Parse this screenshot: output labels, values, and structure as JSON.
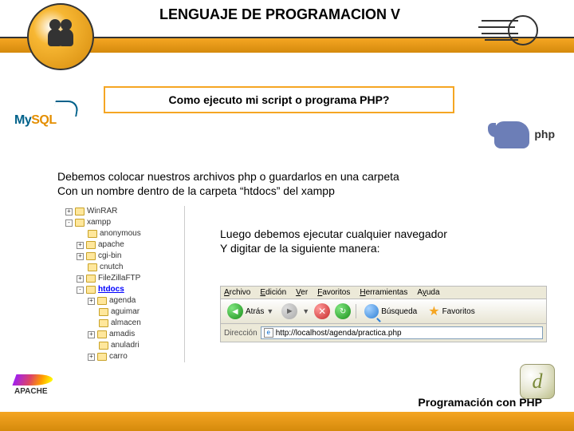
{
  "header": {
    "title": "LENGUAJE DE PROGRAMACION V",
    "subtitle": "Como ejecuto mi script o programa PHP?"
  },
  "logos": {
    "mysql_my": "My",
    "mysql_sql": "SQL",
    "php": "php",
    "apache": "APACHE",
    "dw": "d"
  },
  "body": {
    "line1": "Debemos colocar nuestros archivos php o guardarlos en una carpeta",
    "line2": "Con un nombre dentro de la carpeta “htdocs” del xampp",
    "instr_line1": "Luego debemos ejecutar cualquier navegador",
    "instr_line2": "Y digitar de la siguiente manera:"
  },
  "tree": {
    "items": [
      {
        "level": "l1",
        "exp": "+",
        "label": "WinRAR"
      },
      {
        "level": "l1",
        "exp": "-",
        "label": "xampp"
      },
      {
        "level": "l2",
        "exp": "",
        "label": "anonymous"
      },
      {
        "level": "l2",
        "exp": "+",
        "label": "apache"
      },
      {
        "level": "l2",
        "exp": "+",
        "label": "cgi-bin"
      },
      {
        "level": "l2",
        "exp": "",
        "label": "cnutch"
      },
      {
        "level": "l2",
        "exp": "+",
        "label": "FileZillaFTP"
      },
      {
        "level": "l2",
        "exp": "-",
        "label": "htdocs",
        "hl": true
      },
      {
        "level": "l3",
        "exp": "+",
        "label": "agenda"
      },
      {
        "level": "l3",
        "exp": "",
        "label": "aguimar"
      },
      {
        "level": "l3",
        "exp": "",
        "label": "almacen"
      },
      {
        "level": "l3",
        "exp": "+",
        "label": "amadis"
      },
      {
        "level": "l3",
        "exp": "",
        "label": "anuladri"
      },
      {
        "level": "l3",
        "exp": "+",
        "label": "carro"
      }
    ]
  },
  "browser": {
    "menu": {
      "archivo": "Archivo",
      "edicion": "Edición",
      "ver": "Ver",
      "favoritos": "Favoritos",
      "herramientas": "Herramientas",
      "ayuda": "Ayuda"
    },
    "toolbar": {
      "back": "Atrás",
      "search": "Búsqueda",
      "favorites": "Favoritos"
    },
    "address": {
      "label": "Dirección",
      "url": "http://localhost/agenda/practica.php"
    }
  },
  "footer": {
    "text": "Programación con PHP"
  }
}
